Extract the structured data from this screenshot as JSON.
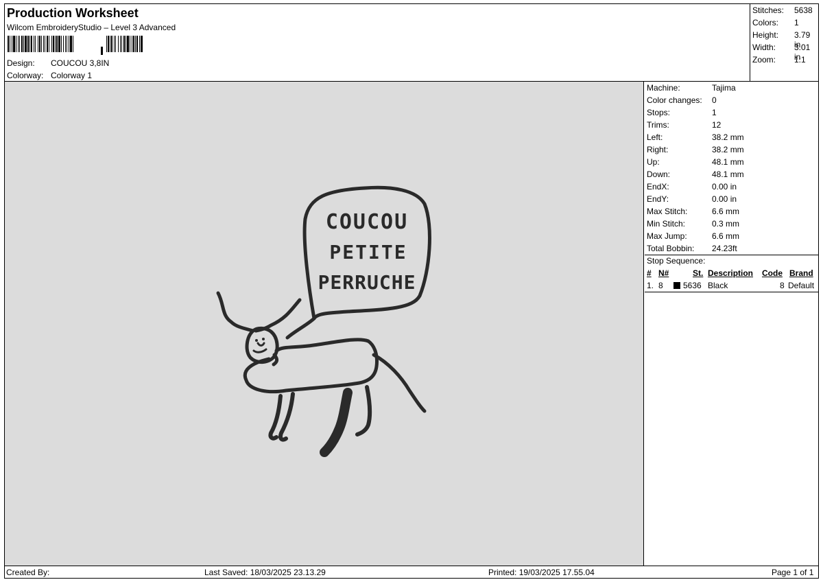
{
  "header": {
    "title": "Production Worksheet",
    "subtitle": "Wilcom EmbroideryStudio – Level 3 Advanced",
    "design_label": "Design:",
    "design_value": "COUCOU 3,8IN",
    "colorway_label": "Colorway:",
    "colorway_value": "Colorway 1"
  },
  "summary": [
    {
      "label": "Stitches:",
      "value": "5638"
    },
    {
      "label": "Colors:",
      "value": "1"
    },
    {
      "label": "Height:",
      "value": "3.79 in"
    },
    {
      "label": "Width:",
      "value": "3.01 in"
    },
    {
      "label": "Zoom:",
      "value": "1:1"
    }
  ],
  "design_text": [
    "COUCOU",
    "PETITE",
    "PERRUCHE"
  ],
  "thread_color": "#2a2a2a",
  "canvas_bg": "#dcdcdc",
  "machine_info": [
    {
      "label": "Machine:",
      "value": "Tajima"
    },
    {
      "label": "Color changes:",
      "value": "0"
    },
    {
      "label": "Stops:",
      "value": "1"
    },
    {
      "label": "Trims:",
      "value": "12"
    },
    {
      "label": "Left:",
      "value": "38.2 mm"
    },
    {
      "label": "Right:",
      "value": "38.2 mm"
    },
    {
      "label": "Up:",
      "value": "48.1 mm"
    },
    {
      "label": "Down:",
      "value": "48.1 mm"
    },
    {
      "label": "EndX:",
      "value": "0.00 in"
    },
    {
      "label": "EndY:",
      "value": "0.00 in"
    },
    {
      "label": "Max Stitch:",
      "value": "6.6 mm"
    },
    {
      "label": "Min Stitch:",
      "value": "0.3 mm"
    },
    {
      "label": "Max Jump:",
      "value": "6.6 mm"
    },
    {
      "label": "Total Bobbin:",
      "value": "24.23ft"
    }
  ],
  "stop_sequence": {
    "title": "Stop Sequence:",
    "headers": {
      "num": "#",
      "n": "N#",
      "st": "St.",
      "description": "Description",
      "code": "Code",
      "brand": "Brand"
    },
    "rows": [
      {
        "num": "1.",
        "n": "8",
        "swatch_color": "#000000",
        "st": "5636",
        "description": "Black",
        "code": "8",
        "brand": "Default"
      }
    ]
  },
  "footer": {
    "created_by": "Created By:",
    "last_saved": "Last Saved: 18/03/2025 23.13.29",
    "printed": "Printed: 19/03/2025 17.55.04",
    "page": "Page 1 of 1"
  }
}
